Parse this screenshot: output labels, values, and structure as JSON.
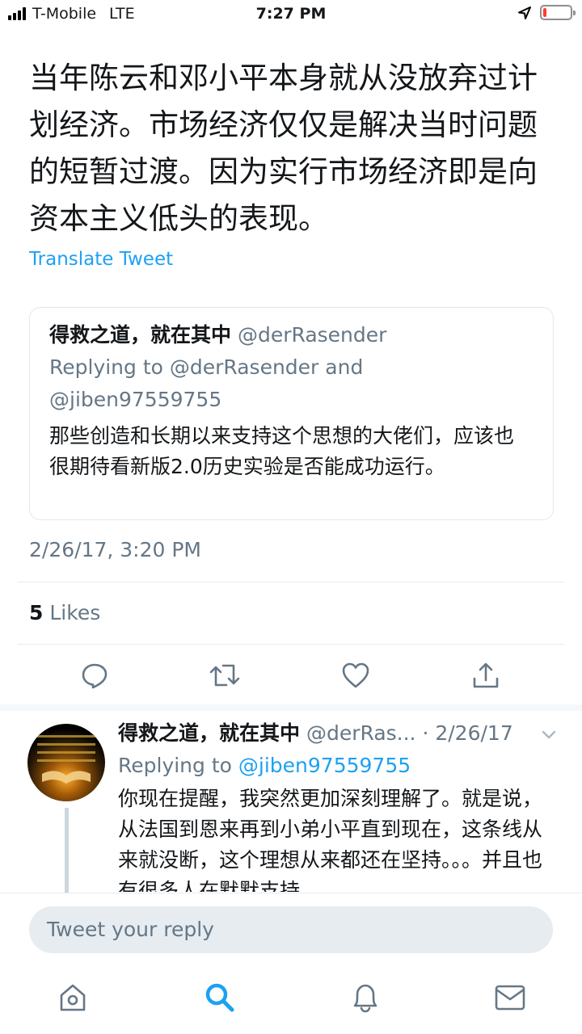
{
  "status_bar": {
    "carrier": "T-Mobile",
    "network": "LTE",
    "time": "7:27 PM",
    "battery_level": 0.12,
    "battery_color": "#ff3b30"
  },
  "tweet": {
    "text": "当年陈云和邓小平本身就从没放弃过计划经济。市场经济仅仅是解决当时问题的短暂过渡。因为实行市场经济即是向资本主义低头的表现。",
    "translate_label": "Translate Tweet",
    "quoted": {
      "name": "得救之道，就在其中",
      "handle": "@derRasender",
      "replying_to": "Replying to @derRasender and @jiben97559755",
      "text": "那些创造和长期以来支持这个思想的大佬们，应该也很期待看新版2.0历史实验是否能成功运行。"
    },
    "timestamp": "2/26/17, 3:20 PM",
    "likes_count": "5",
    "likes_label": "Likes",
    "actions": [
      "reply-icon",
      "retweet-icon",
      "like-icon",
      "share-icon"
    ]
  },
  "reply": {
    "name": "得救之道，就在其中",
    "meta": "@derRas... · 2/26/17",
    "replying_prefix": "Replying to",
    "replying_handle": "@jiben97559755",
    "text": "你现在提醒，我突然更加深刻理解了。就是说，从法国到恩来再到小弟小平直到现在，这条线从来就没断，这个理想从来都还在坚持。。。并且也有很多人在默默支持。。。"
  },
  "compose": {
    "placeholder": "Tweet your reply"
  },
  "tab_bar": {
    "tabs": [
      "home-icon",
      "search-icon",
      "notifications-icon",
      "messages-icon"
    ],
    "active_tab": "search-icon",
    "active_color": "#1da1f2",
    "inactive_color": "#657786"
  },
  "colors": {
    "link": "#1da1f2",
    "secondary_text": "#657786",
    "primary_text": "#14171a"
  }
}
